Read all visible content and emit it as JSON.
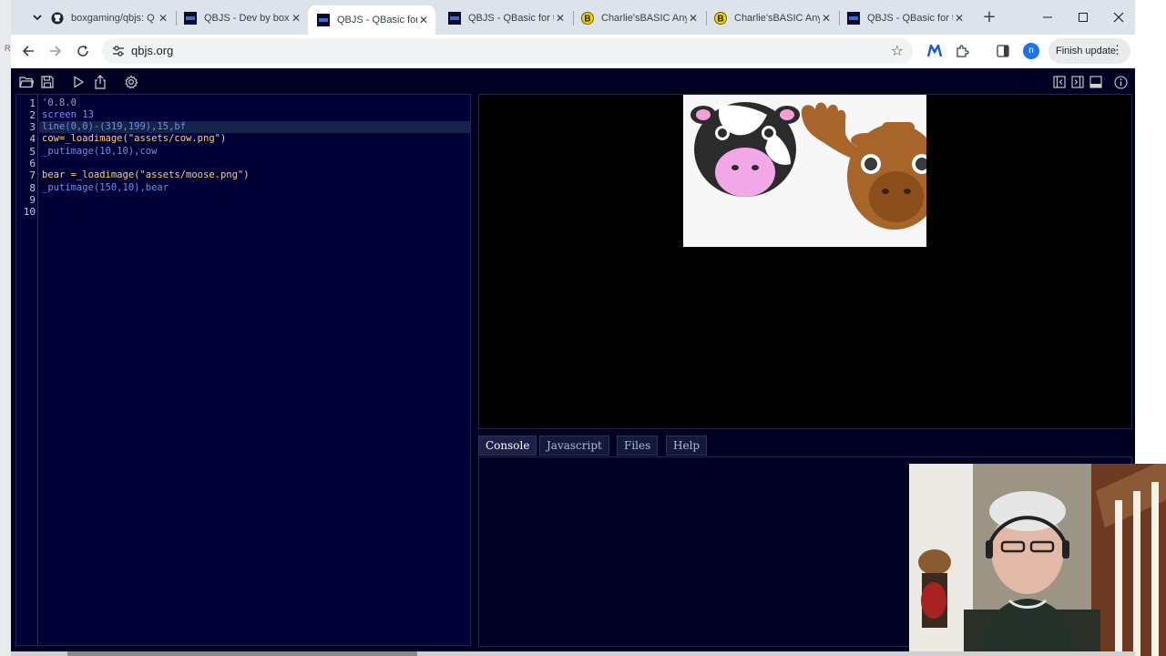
{
  "browser": {
    "tabs": [
      {
        "title": "boxgaming/qbjs: Q",
        "favicon": "github-icon"
      },
      {
        "title": "QBJS - Dev by boxg",
        "favicon": "qbjs-icon"
      },
      {
        "title": "QBJS - QBasic for th",
        "favicon": "qbjs-icon",
        "active": true
      },
      {
        "title": "QBJS - QBasic for th",
        "favicon": "qbjs-icon"
      },
      {
        "title": "Charlie'sBASIC Any",
        "favicon": "b-icon"
      },
      {
        "title": "Charlie'sBASIC Any",
        "favicon": "b-icon"
      },
      {
        "title": "QBJS - QBasic for th",
        "favicon": "qbjs-icon"
      }
    ],
    "address": "qbjs.org",
    "update_button": "Finish update",
    "profile_initial": "n"
  },
  "editor": {
    "lines": [
      {
        "n": "1",
        "text": "'0.8.0"
      },
      {
        "n": "2",
        "text": "screen 13"
      },
      {
        "n": "3",
        "text": "line(0,0)-(319,199),15,bf"
      },
      {
        "n": "4",
        "text": "cow=_loadimage(\"assets/cow.png\")"
      },
      {
        "n": "5",
        "text": "_putimage(10,10),cow"
      },
      {
        "n": "6",
        "text": ""
      },
      {
        "n": "7",
        "text": "bear =_loadimage(\"assets/moose.png\")"
      },
      {
        "n": "8",
        "text": "_putimage(150,10),bear"
      },
      {
        "n": "9",
        "text": ""
      },
      {
        "n": "10",
        "text": ""
      }
    ]
  },
  "output_tabs": [
    "Console",
    "Javascript",
    "Files",
    "Help"
  ],
  "colors": {
    "app_bg": "#000022",
    "editor_bg": "#000036",
    "canvas_bg": "#f7f7f7"
  }
}
